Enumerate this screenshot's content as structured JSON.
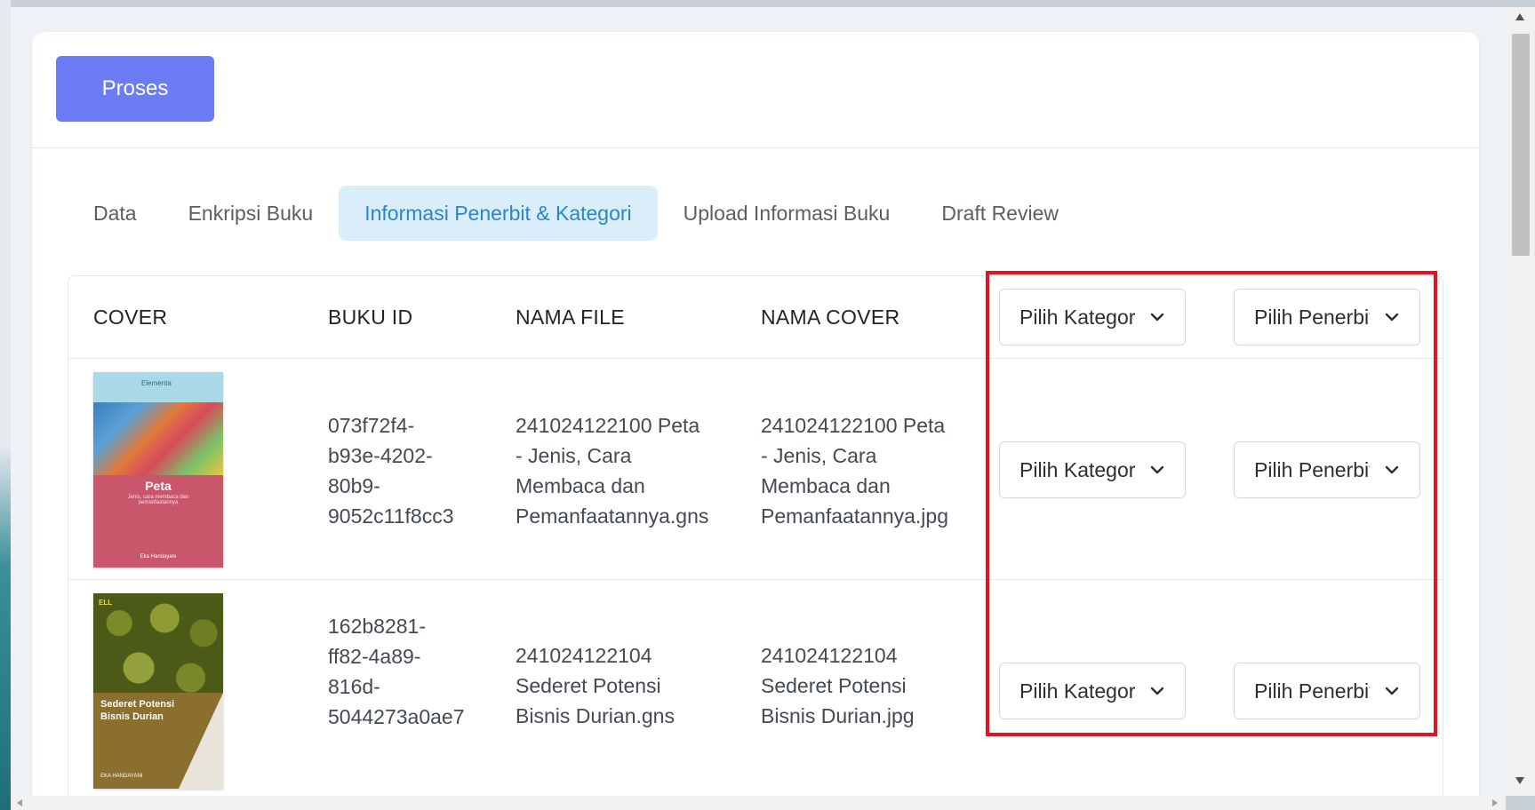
{
  "toolbar": {
    "proses_label": "Proses"
  },
  "tabs": [
    {
      "label": "Data"
    },
    {
      "label": "Enkripsi Buku"
    },
    {
      "label": "Informasi Penerbit & Kategori",
      "active": true
    },
    {
      "label": "Upload Informasi Buku"
    },
    {
      "label": "Draft Review"
    }
  ],
  "table": {
    "headers": {
      "cover": "COVER",
      "buku_id": "BUKU ID",
      "nama_file": "NAMA FILE",
      "nama_cover": "NAMA COVER",
      "kategori_select": "Pilih Kategori",
      "penerbit_select": "Pilih Penerbit"
    },
    "rows": [
      {
        "cover": {
          "title": "Peta",
          "subtitle": "Jenis, cara membaca dan pemanfaatannya",
          "author": "Eka Handayani",
          "brand": "Elementa"
        },
        "buku_id": [
          "073f72f4-",
          "b93e-4202-",
          "80b9-",
          "9052c11f8cc3"
        ],
        "nama_file": [
          "241024122100 Peta",
          "- Jenis, Cara",
          "Membaca dan",
          "Pemanfaatannya.gns"
        ],
        "nama_cover": [
          "241024122100 Peta",
          "- Jenis, Cara",
          "Membaca dan",
          "Pemanfaatannya.jpg"
        ],
        "kategori": "Pilih Kategori",
        "penerbit": "Pilih Penerbit"
      },
      {
        "cover": {
          "title": "Sederet Potensi Bisnis Durian",
          "author": "EKA HANDAYANI",
          "brand": "ELL"
        },
        "buku_id": [
          "162b8281-",
          "ff82-4a89-",
          "816d-",
          "5044273a0ae7"
        ],
        "nama_file": [
          "241024122104",
          "Sederet Potensi",
          "Bisnis Durian.gns"
        ],
        "nama_cover": [
          "241024122104",
          "Sederet Potensi",
          "Bisnis Durian.jpg"
        ],
        "kategori": "Pilih Kategori",
        "penerbit": "Pilih Penerbit"
      }
    ]
  },
  "colors": {
    "accent": "#6c7cf5",
    "tab_active_bg": "#d9edfb",
    "tab_active_text": "#2a86c8",
    "highlight": "#e8101c"
  },
  "icons": {
    "dropdown": "chevron-down-icon"
  }
}
